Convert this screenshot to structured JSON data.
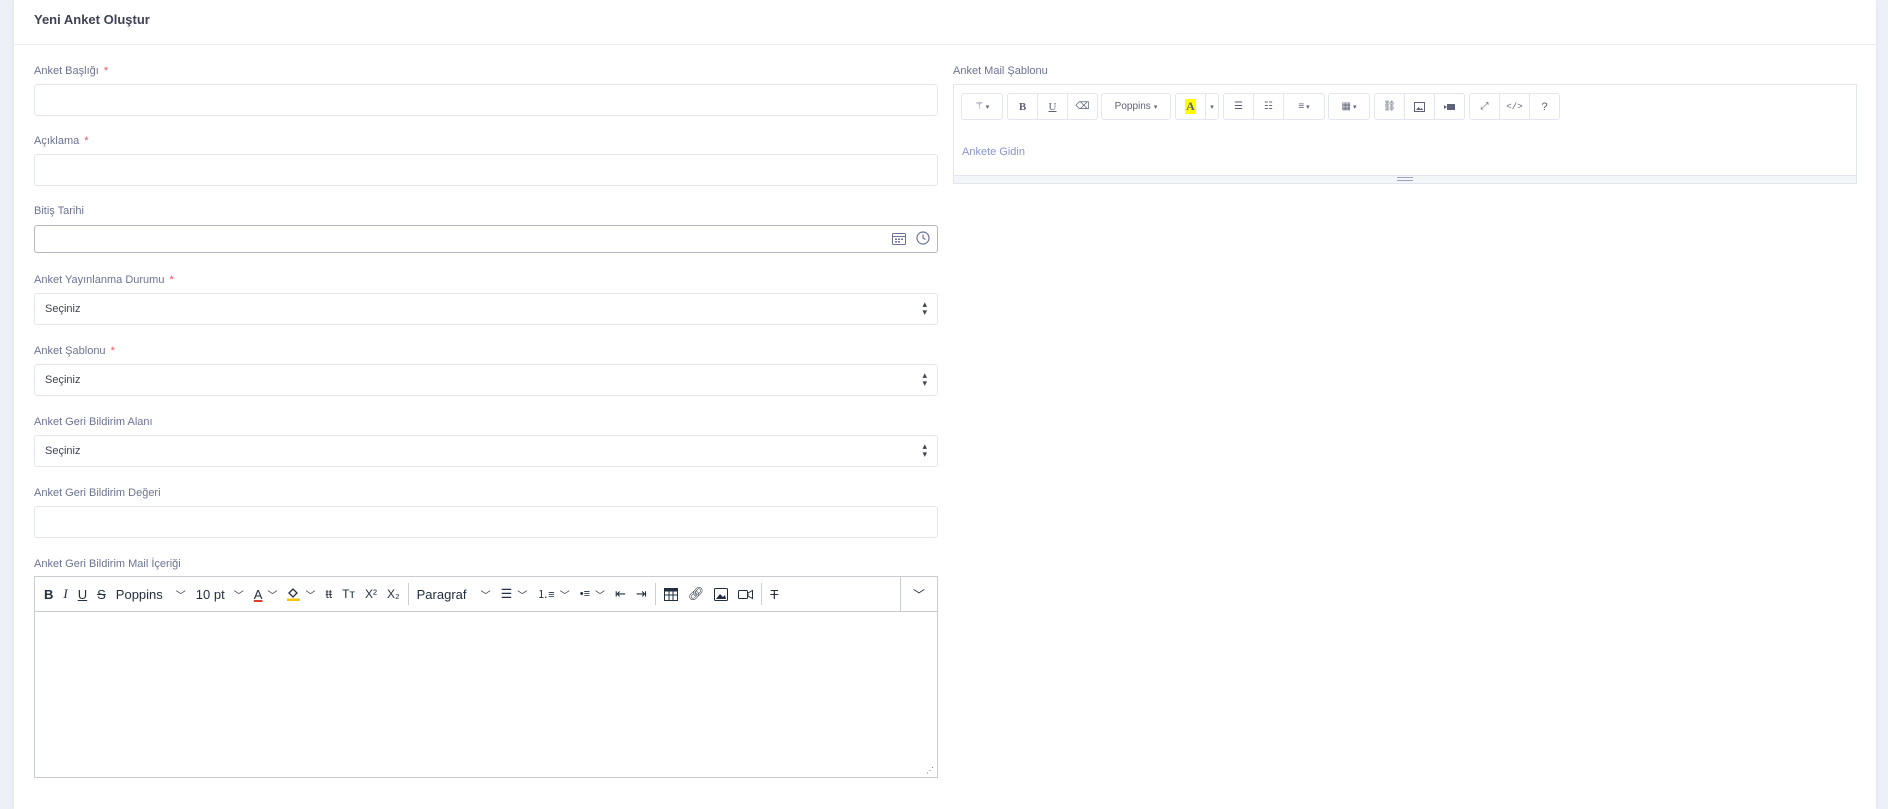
{
  "page": {
    "title": "Yeni Anket Oluştur"
  },
  "form": {
    "survey_title": {
      "label": "Anket Başlığı",
      "required": "*",
      "value": ""
    },
    "description": {
      "label": "Açıklama",
      "required": "*",
      "value": ""
    },
    "end_date": {
      "label": "Bitiş Tarihi",
      "value": ""
    },
    "publish_status": {
      "label": "Anket Yayınlanma Durumu",
      "required": "*",
      "selected": "Seçiniz"
    },
    "survey_template": {
      "label": "Anket Şablonu",
      "required": "*",
      "selected": "Seçiniz"
    },
    "feedback_field": {
      "label": "Anket Geri Bildirim Alanı",
      "selected": "Seçiniz"
    },
    "feedback_value": {
      "label": "Anket Geri Bildirim Değeri",
      "value": ""
    },
    "feedback_mail_content": {
      "label": "Anket Geri Bildirim Mail İçeriği",
      "toolbar": {
        "font": "Poppins",
        "size": "10 pt",
        "block": "Paragraf"
      }
    },
    "mail_template": {
      "label": "Anket Mail Şablonu",
      "toolbar": {
        "font": "Poppins"
      },
      "body_link": "Ankete Gidin"
    }
  },
  "icons": {
    "calendar": "calendar-icon",
    "clock": "clock-icon"
  },
  "colors": {
    "required": "#f64e60",
    "link": "#8994cc",
    "highlight": "#ffff00"
  }
}
